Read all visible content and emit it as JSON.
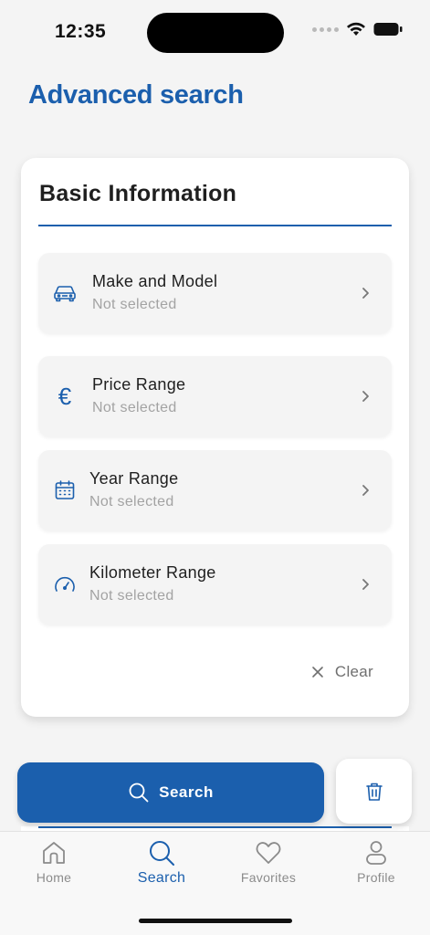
{
  "status_bar": {
    "time": "12:35"
  },
  "page": {
    "title": "Advanced search"
  },
  "basic_info": {
    "title": "Basic Information",
    "rows": [
      {
        "label": "Make and Model",
        "value": "Not selected",
        "icon": "car-icon"
      },
      {
        "label": "Price Range",
        "value": "Not selected",
        "icon": "euro-icon",
        "glyph": "€"
      },
      {
        "label": "Year Range",
        "value": "Not selected",
        "icon": "calendar-icon"
      },
      {
        "label": "Kilometer Range",
        "value": "Not selected",
        "icon": "speedometer-icon"
      }
    ],
    "clear_label": "Clear"
  },
  "actions": {
    "search_label": "Search"
  },
  "tab_bar": {
    "tabs": [
      {
        "label": "Home",
        "icon": "home-icon",
        "active": false
      },
      {
        "label": "Search",
        "icon": "search-icon",
        "active": true
      },
      {
        "label": "Favorites",
        "icon": "heart-icon",
        "active": false
      },
      {
        "label": "Profile",
        "icon": "user-icon",
        "active": false
      }
    ]
  },
  "colors": {
    "accent": "#1b5fad",
    "muted": "#a3a3a3",
    "background": "#f4f4f4"
  }
}
